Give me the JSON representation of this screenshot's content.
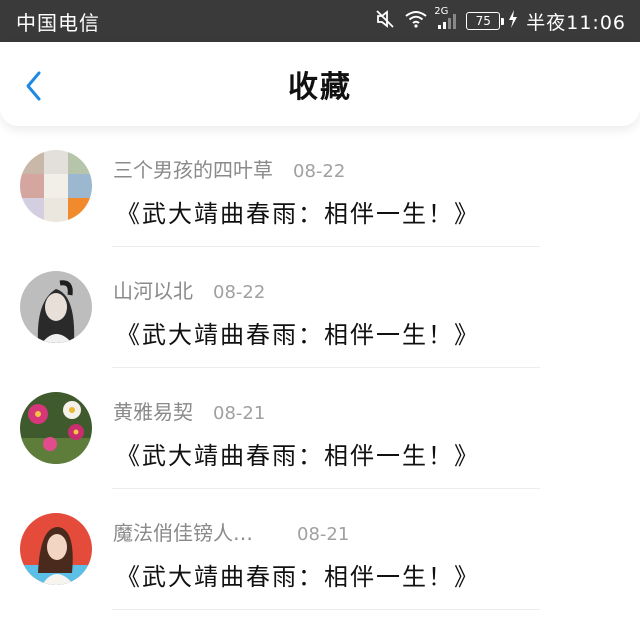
{
  "status_bar": {
    "carrier": "中国电信",
    "network": "2G",
    "battery": "75",
    "time": "半夜11:06"
  },
  "header": {
    "title": "收藏"
  },
  "items": [
    {
      "name": "三个男孩的四叶草",
      "date": "08-22",
      "title": "《武大靖曲春雨：相伴一生！》"
    },
    {
      "name": "山河以北",
      "date": "08-22",
      "title": "《武大靖曲春雨：相伴一生！》"
    },
    {
      "name": "黄雅易契",
      "date": "08-21",
      "title": "《武大靖曲春雨：相伴一生！》"
    },
    {
      "name": "魔法俏佳镑人…",
      "date": "08-21",
      "title": "《武大靖曲春雨：相伴一生！》"
    }
  ],
  "colors": {
    "status_bar_bg": "#3a3a3a",
    "accent": "#1e88e5"
  }
}
